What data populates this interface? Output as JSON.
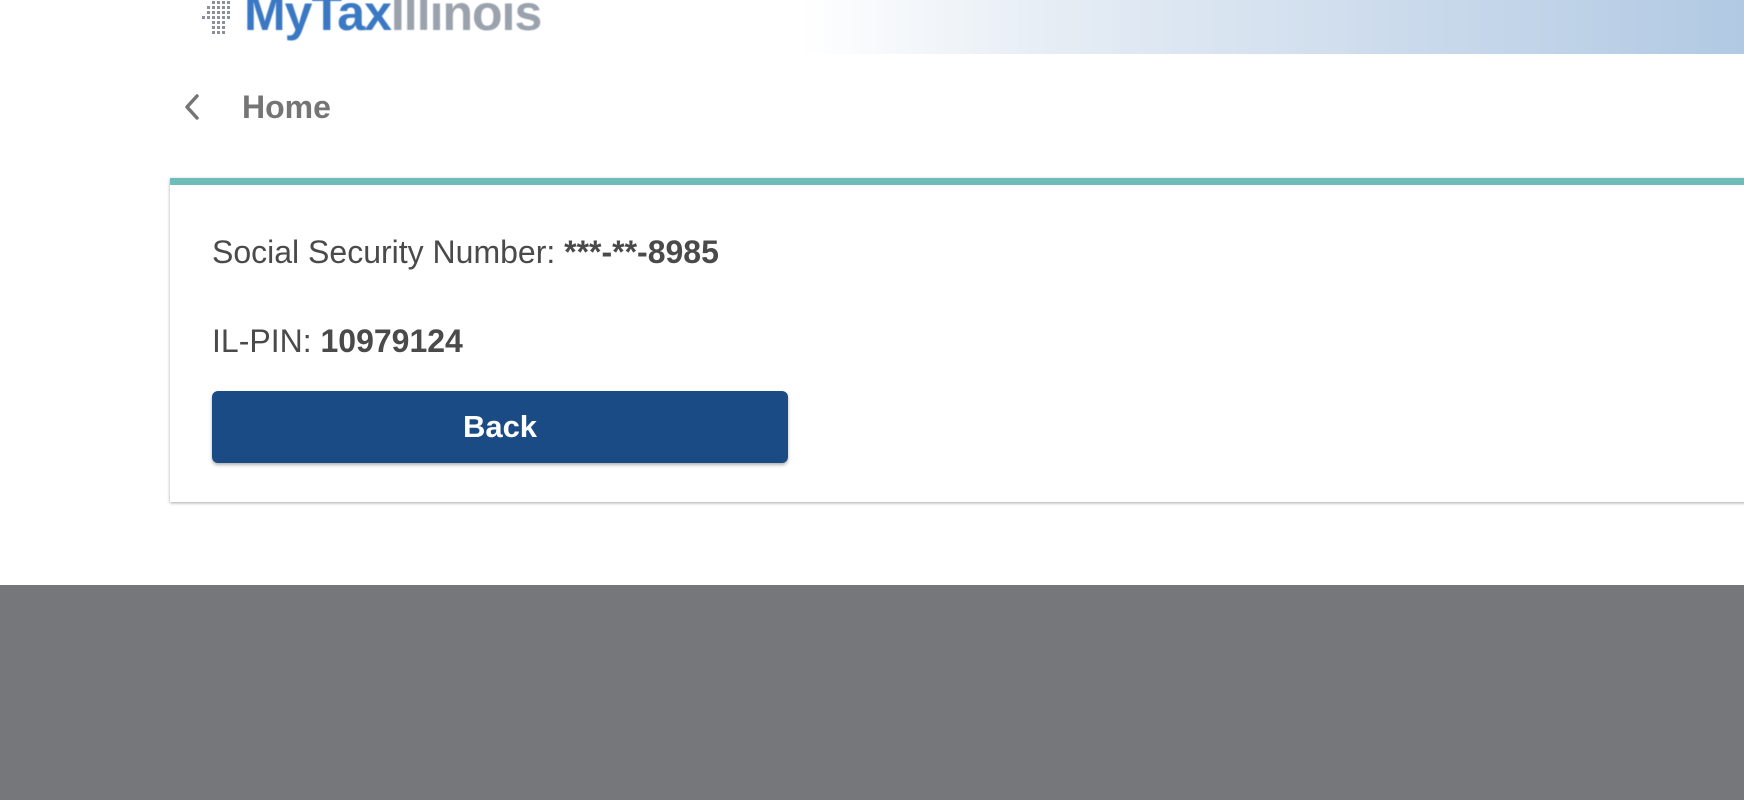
{
  "header": {
    "logo": {
      "text_part1": "MyTax",
      "text_part2": "Illinois",
      "icon": "dot-grid-logo-icon"
    }
  },
  "breadcrumb": {
    "icon": "chevron-left-icon",
    "label": "Home"
  },
  "card": {
    "ssn_label": "Social Security Number: ",
    "ssn_value": "***-**-8985",
    "pin_label": "IL-PIN: ",
    "pin_value": "10979124",
    "back_button_label": "Back"
  },
  "colors": {
    "accent_border": "#6fbdbb",
    "primary_button": "#1b4b84",
    "footer": "#76777b",
    "logo_blue": "#3a78c4"
  }
}
